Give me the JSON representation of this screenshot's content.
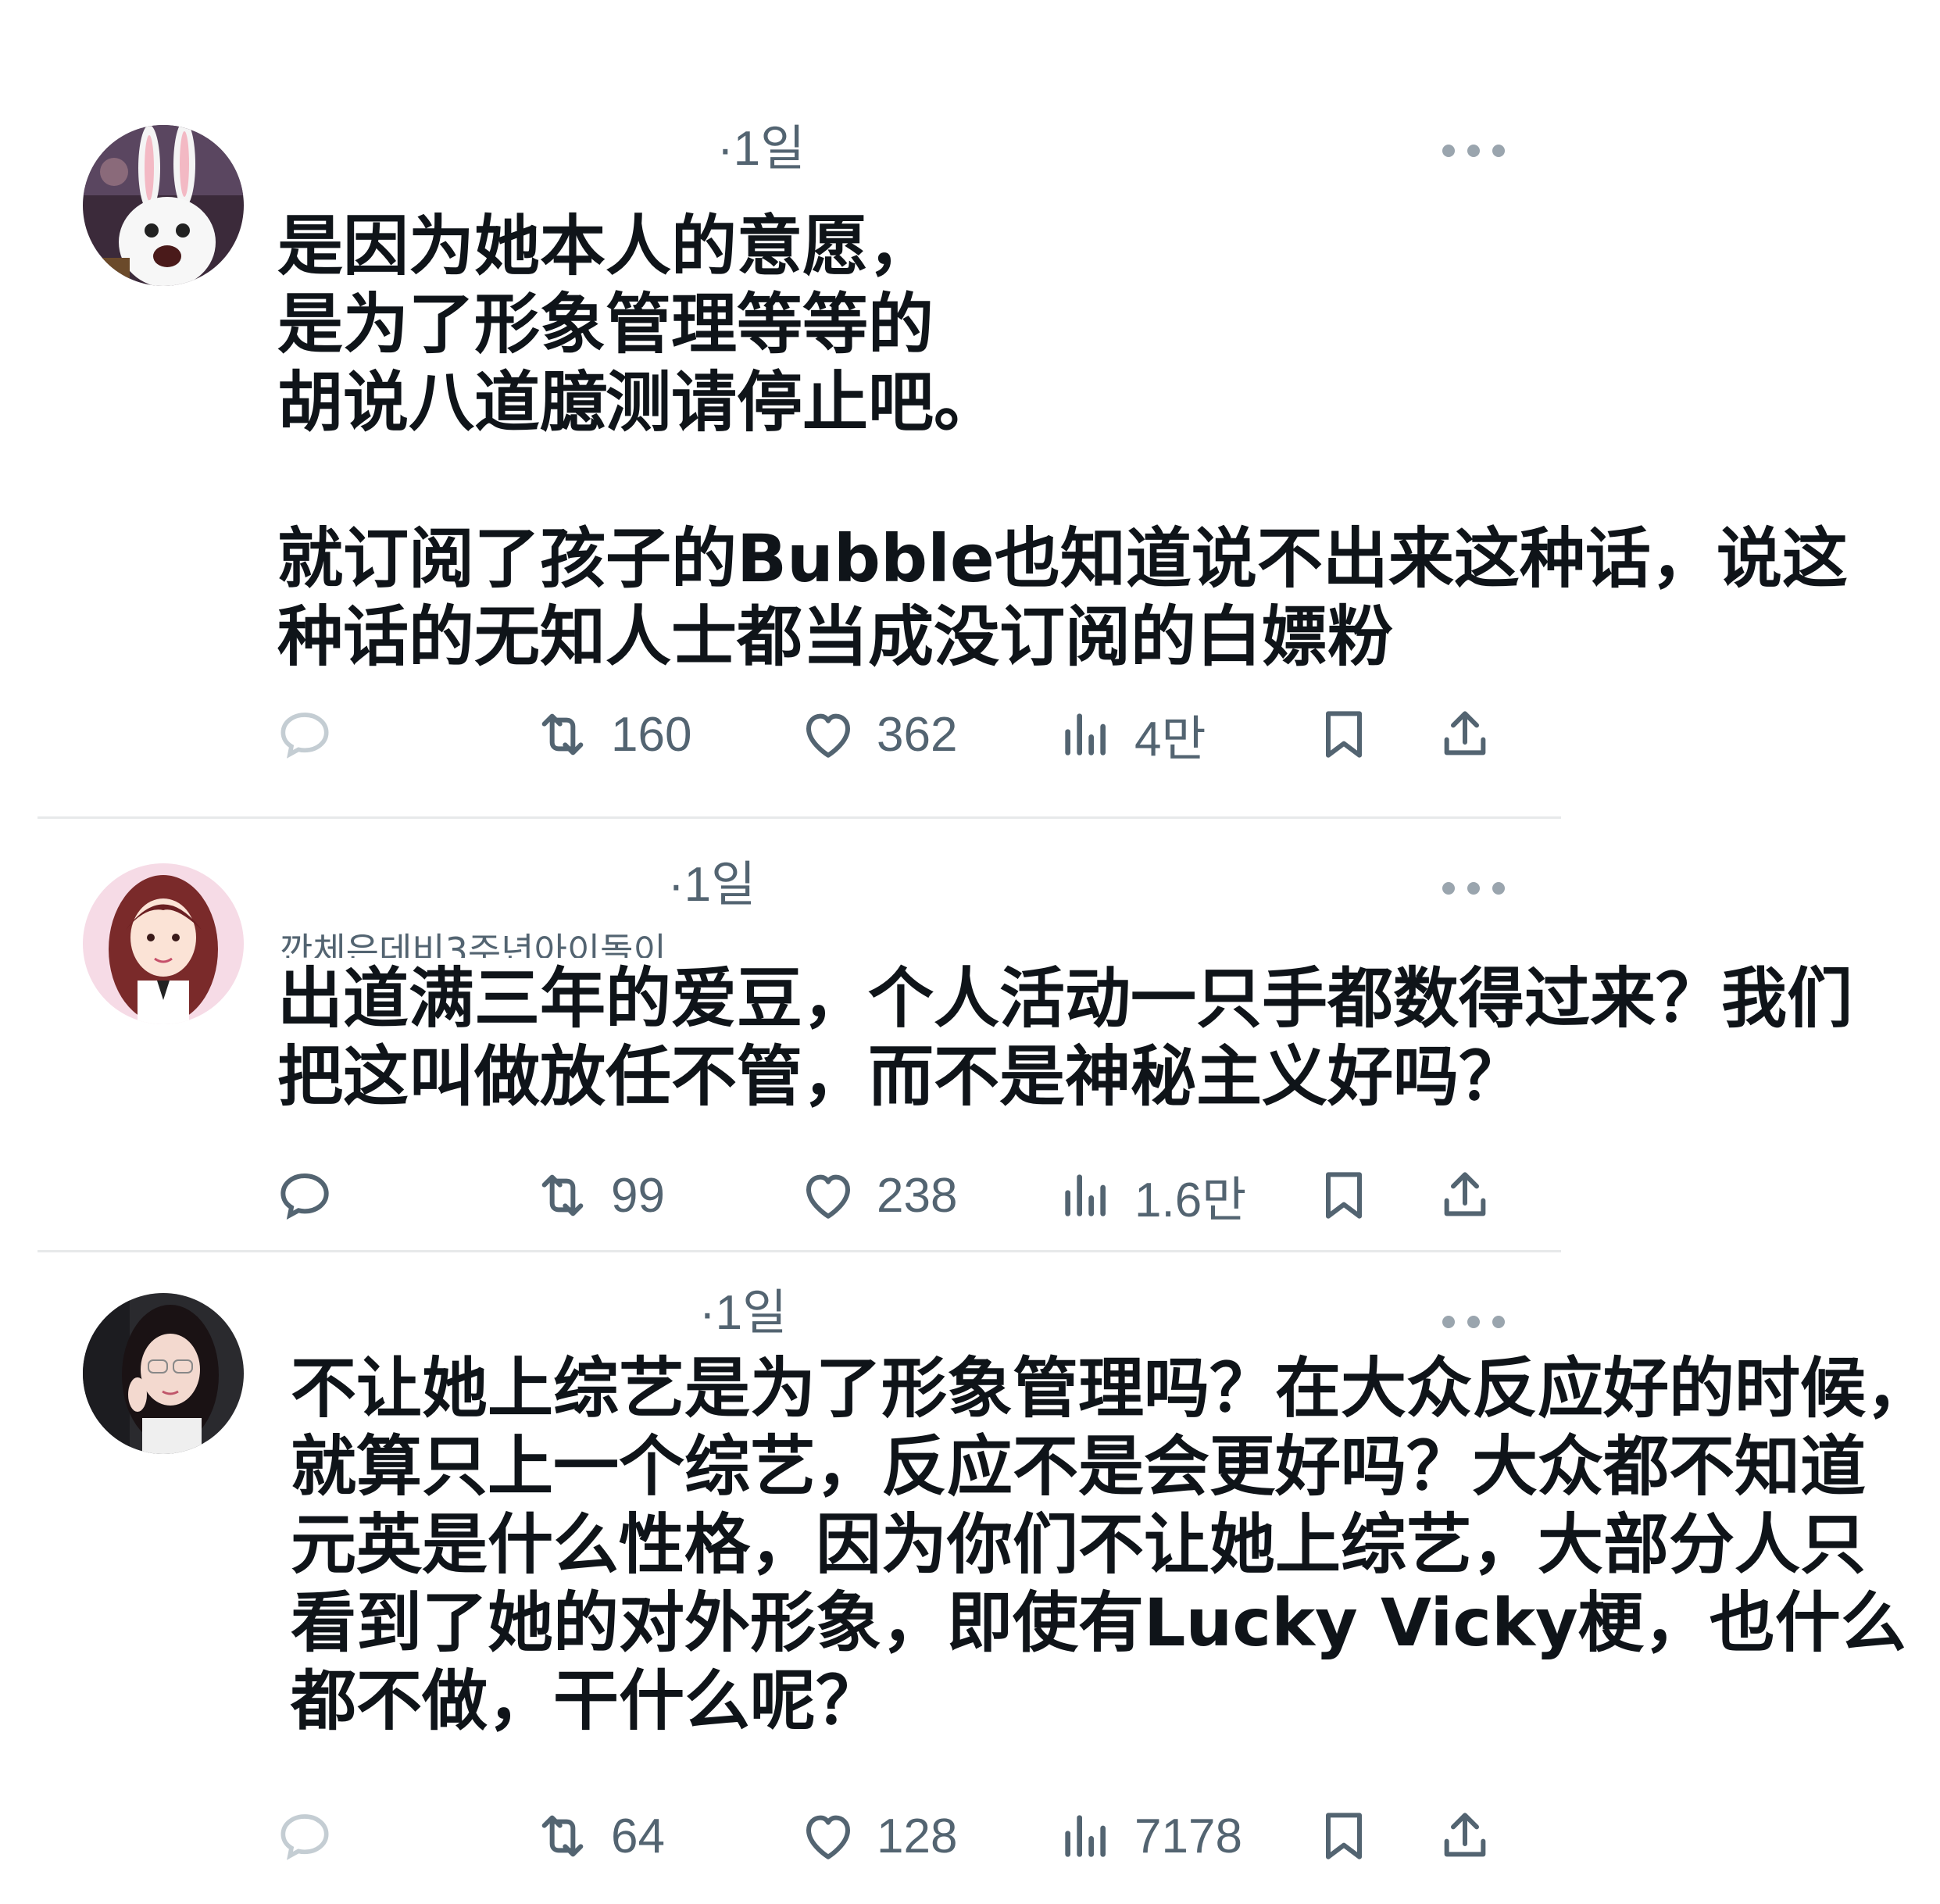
{
  "posts": [
    {
      "time": "·1일",
      "text": "是因为她本人的意愿，\n是为了形象管理等等的\n胡说八道臆测请停止吧。\n\n就订阅了孩子的Bubble也知道说不出来这种话，说这\n种话的无知人士都当成没订阅的白嫖粉",
      "retweets": "160",
      "likes": "362",
      "views": "4만",
      "avatar_icon": "white-rabbit-avatar"
    },
    {
      "time": "·1일",
      "handle": "깐체은데비3주년아이돌이",
      "text": "出道满三年的爱豆，个人活动一只手都数得过来？我们\n把这叫做放任不管，而不是神秘主义好吗？",
      "retweets": "99",
      "likes": "238",
      "views": "1.6만",
      "avatar_icon": "illustrated-girl-avatar"
    },
    {
      "time": "·1일",
      "text": "不让她上综艺是为了形象管理吗？在大众反应好的时候，\n就算只上一个综艺，反应不是会更好吗？大众都不知道\n元英是什么性格，因为你们不让她上综艺，大部分人只\n看到了她的对外形象，即使有Lucky Vicky梗，也什么\n都不做，干什么呢？",
      "retweets": "64",
      "likes": "128",
      "views": "7178",
      "avatar_icon": "photo-girl-avatar"
    }
  ],
  "colors": {
    "text": "#0f1419",
    "muted": "#536471",
    "divider": "#e7e9ea"
  }
}
